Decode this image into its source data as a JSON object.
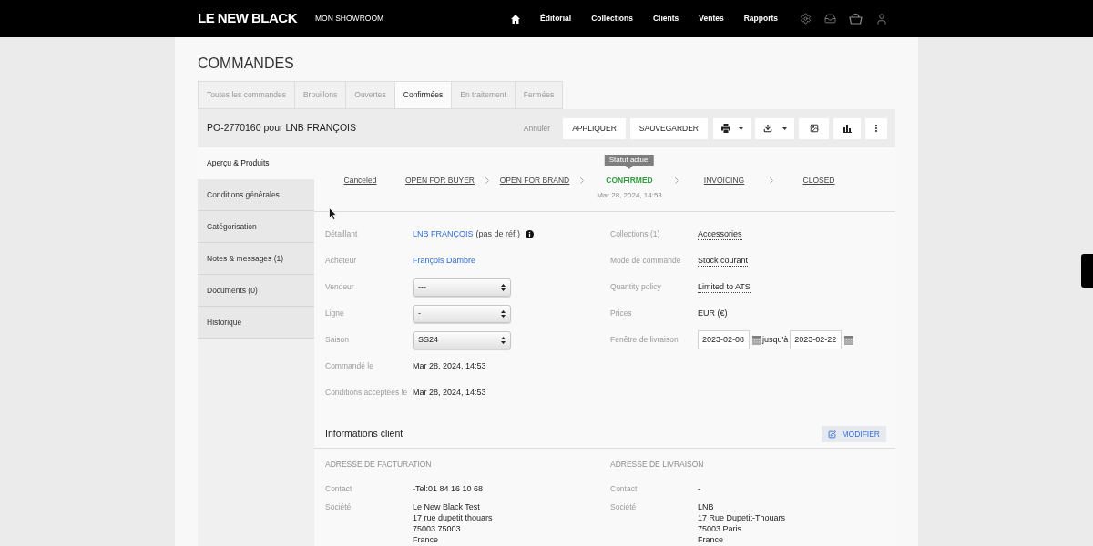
{
  "nav": {
    "logo": "LE NEW BLACK",
    "showroom": "MON SHOWROOM",
    "links": [
      "Éditorial",
      "Collections",
      "Clients",
      "Ventes",
      "Rapports"
    ]
  },
  "page": {
    "title": "COMMANDES"
  },
  "tabs": [
    {
      "label": "Toutes les commandes",
      "selected": false
    },
    {
      "label": "Brouillons",
      "selected": false
    },
    {
      "label": "Ouvertes",
      "selected": false
    },
    {
      "label": "Confirmées",
      "selected": true
    },
    {
      "label": "En traitement",
      "selected": false
    },
    {
      "label": "Fermées",
      "selected": false
    }
  ],
  "order_bar": {
    "title": "PO-2770160 pour LNB FRANÇOIS",
    "cancel": "Annuler",
    "buttons": [
      "APPLIQUER",
      "SAUVEGARDER"
    ]
  },
  "sidebar": {
    "items": [
      {
        "label": "Aperçu & Produits",
        "selected": true
      },
      {
        "label": "Conditions générales",
        "selected": false
      },
      {
        "label": "Catégorisation",
        "selected": false
      },
      {
        "label": "Notes & messages (1)",
        "selected": false
      },
      {
        "label": "Documents (0)",
        "selected": false
      },
      {
        "label": "Historique",
        "selected": false
      }
    ]
  },
  "status": {
    "tooltip": "Statut actuel",
    "steps": [
      {
        "kind": "cancel",
        "label": "Canceled",
        "current": false
      },
      {
        "kind": "step",
        "label": "OPEN FOR BUYER",
        "current": false
      },
      {
        "kind": "step",
        "label": "OPEN FOR BRAND",
        "current": false
      },
      {
        "kind": "step",
        "label": "CONFIRMED",
        "current": true,
        "date": "Mar 28, 2024, 14:53"
      },
      {
        "kind": "step",
        "label": "INVOICING",
        "current": false
      },
      {
        "kind": "step",
        "label": "CLOSED",
        "current": false
      }
    ]
  },
  "details": {
    "left": [
      {
        "kind": "reference",
        "label": "Détaillant",
        "value": "LNB FRANÇOIS",
        "note": "(pas de réf.)"
      },
      {
        "kind": "link",
        "label": "Acheteur",
        "value": "François Dambre"
      },
      {
        "kind": "select",
        "label": "Vendeur",
        "value": "---"
      },
      {
        "kind": "select",
        "label": "Ligne",
        "value": "-"
      },
      {
        "kind": "select",
        "label": "Saison",
        "value": "SS24"
      },
      {
        "kind": "text",
        "label": "Commandé le",
        "value": "Mar 28, 2024, 14:53"
      },
      {
        "kind": "text",
        "label": "Conditions acceptées le",
        "value": "Mar 28, 2024, 14:53"
      }
    ],
    "right": [
      {
        "kind": "dotted",
        "label": "Collections (1)",
        "value": "Accessories"
      },
      {
        "kind": "dotted",
        "label": "Mode de commande",
        "value": "Stock courant"
      },
      {
        "kind": "dotted",
        "label": "Quantity policy",
        "value": "Limited to ATS"
      },
      {
        "kind": "text",
        "label": "Prices",
        "value": "EUR (€)"
      },
      {
        "kind": "daterange",
        "label": "Fenêtre de livraison",
        "from": "2023-02-08",
        "separator": "jusqu'à",
        "to": "2023-02-22"
      }
    ]
  },
  "client": {
    "title": "Informations client",
    "button": "MODIFIER",
    "columns": [
      {
        "heading": "ADRESSE DE FACTURATION",
        "rows": [
          {
            "label": "Contact",
            "lines": [
              "-Tel:01 84 16 10 68"
            ]
          },
          {
            "label": "Société",
            "lines": [
              "Le New Black Test",
              "17 rue dupetit thouars",
              "75003 75003",
              "France"
            ]
          }
        ]
      },
      {
        "heading": "ADRESSE DE LIVRAISON",
        "rows": [
          {
            "label": "Contact",
            "lines": [
              "-"
            ]
          },
          {
            "label": "Société",
            "lines": [
              "LNB",
              "17 Rue Dupetit-Thouars",
              "75003 Paris",
              "France"
            ]
          }
        ]
      }
    ]
  }
}
